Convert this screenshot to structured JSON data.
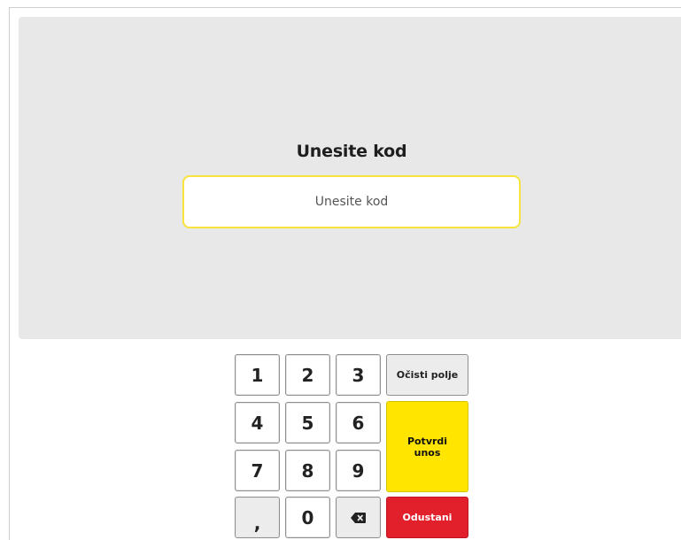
{
  "prompt": {
    "title": "Unesite kod",
    "input_value": "",
    "input_placeholder": "Unesite kod"
  },
  "keypad": {
    "keys": [
      "1",
      "2",
      "3",
      "4",
      "5",
      "6",
      "7",
      "8",
      "9",
      ",",
      "0"
    ],
    "backspace_icon": "backspace-icon"
  },
  "actions": {
    "clear_label": "Očisti polje",
    "confirm_label": "Potvrdi unos",
    "cancel_label": "Odustani"
  },
  "colors": {
    "panel_background": "#e8e8e8",
    "input_border": "#f6e33b",
    "confirm": "#ffe500",
    "cancel": "#e2202c"
  }
}
